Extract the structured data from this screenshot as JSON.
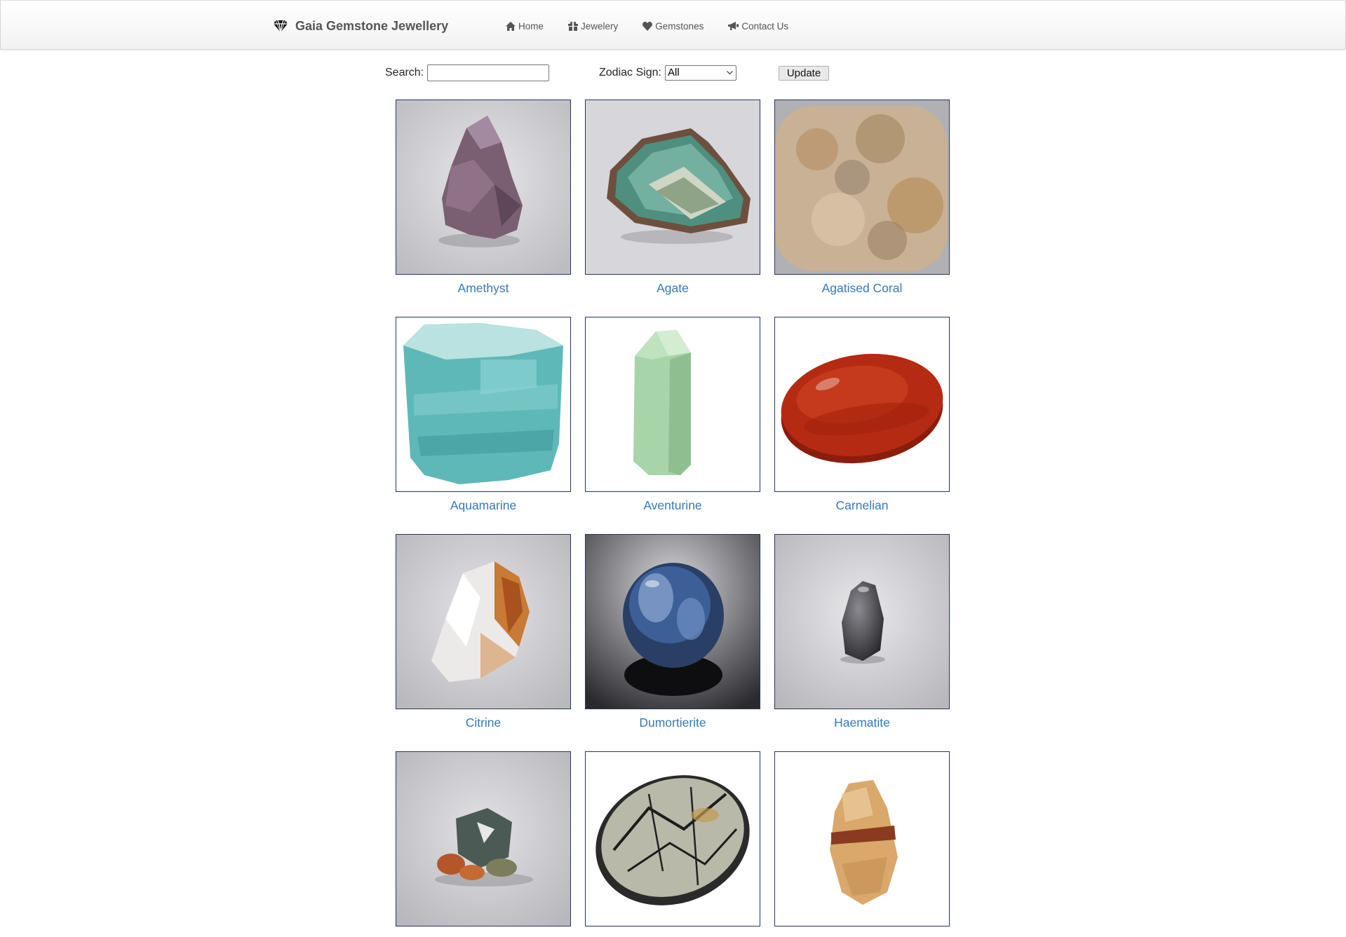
{
  "brand": {
    "name": "Gaia Gemstone Jewellery"
  },
  "nav": [
    {
      "label": "Home"
    },
    {
      "label": "Jewelery"
    },
    {
      "label": "Gemstones"
    },
    {
      "label": "Contact Us"
    }
  ],
  "filters": {
    "search_label": "Search:",
    "search_value": "",
    "zodiac_label": "Zodiac Sign:",
    "zodiac_selected": "All",
    "update_label": "Update"
  },
  "gemstones": [
    {
      "name": "Amethyst",
      "color": "#7a5f72"
    },
    {
      "name": "Agate",
      "color": "#4f8f7f"
    },
    {
      "name": "Agatised Coral",
      "color": "#b8926a"
    },
    {
      "name": "Aquamarine",
      "color": "#5fb8b8"
    },
    {
      "name": "Aventurine",
      "color": "#a7d4a8"
    },
    {
      "name": "Carnelian",
      "color": "#b52a12"
    },
    {
      "name": "Citrine",
      "color": "#c97a34"
    },
    {
      "name": "Dumortierite",
      "color": "#3d5f97"
    },
    {
      "name": "Haematite",
      "color": "#3b3b3f"
    },
    {
      "name": "",
      "color": "#4c5a55"
    },
    {
      "name": "",
      "color": "#2a2a2a"
    },
    {
      "name": "",
      "color": "#d9a86a"
    }
  ]
}
